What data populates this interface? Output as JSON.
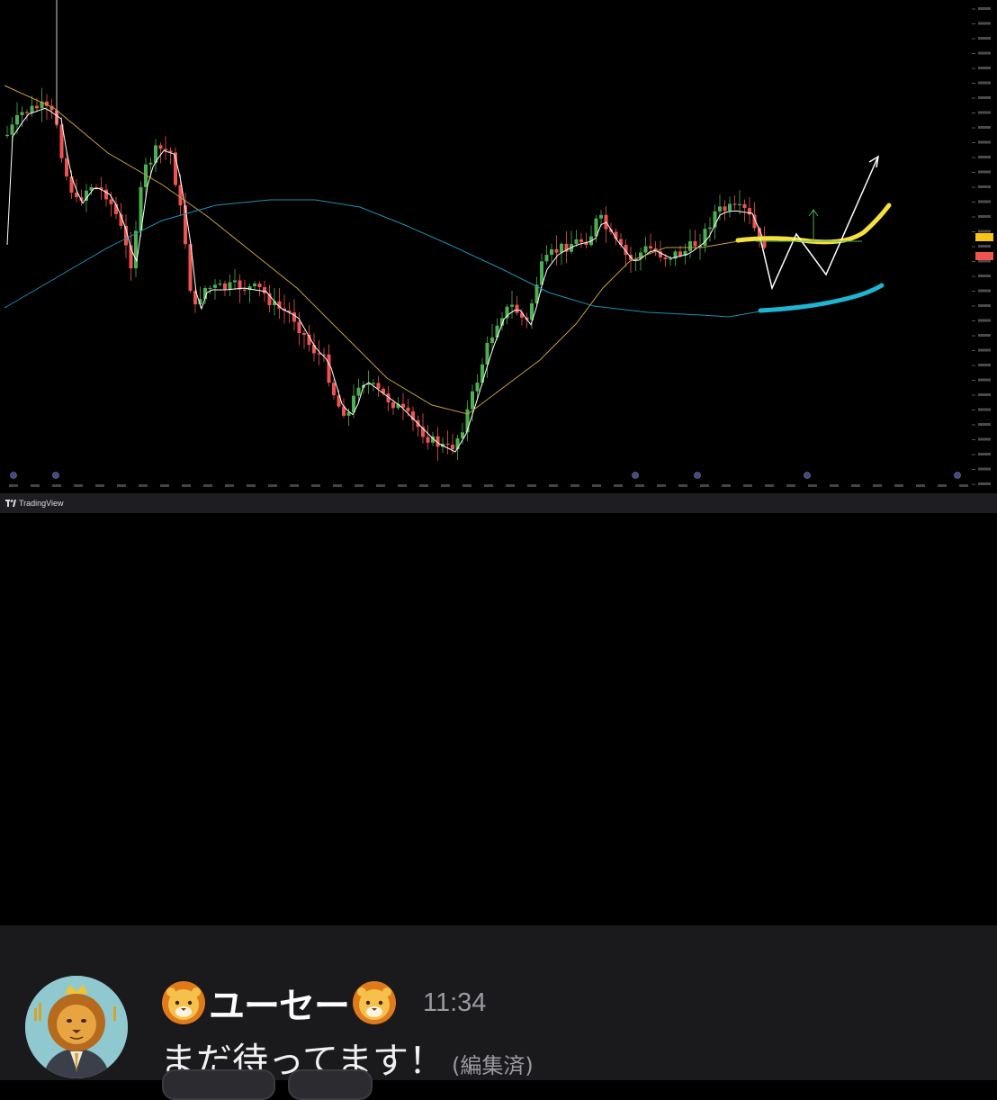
{
  "chart": {
    "brand": "TradingView",
    "background": "#000000",
    "colors": {
      "up_candle": "#4caf50",
      "down_candle": "#ef5350",
      "ma_fast": "#ffffff",
      "ma_mid": "#c8a03c",
      "ma_slow": "#1e8fb4",
      "drawn_yellow": "#f5e13c",
      "drawn_cyan": "#1eb4d2",
      "drawn_white": "#ffffff",
      "drawn_arrow_green": "#4caf50",
      "price_badge_yellow": "#f5c518",
      "price_badge_red": "#ef5350"
    },
    "annotations": [
      "yellow-resistance-curve",
      "cyan-support-curve",
      "white-w-pattern-with-arrow",
      "green-up-arrow"
    ]
  },
  "message": {
    "username": "ユーセー",
    "username_prefix_icon": "lion-face-emoji",
    "username_suffix_icon": "lion-face-emoji",
    "timestamp": "11:34",
    "text": "まだ待ってます！",
    "edited": "(編集済)"
  },
  "colors": {
    "message_bg": "#1a1a1d",
    "username": "#ffffff",
    "timestamp": "#9a9aa0"
  }
}
